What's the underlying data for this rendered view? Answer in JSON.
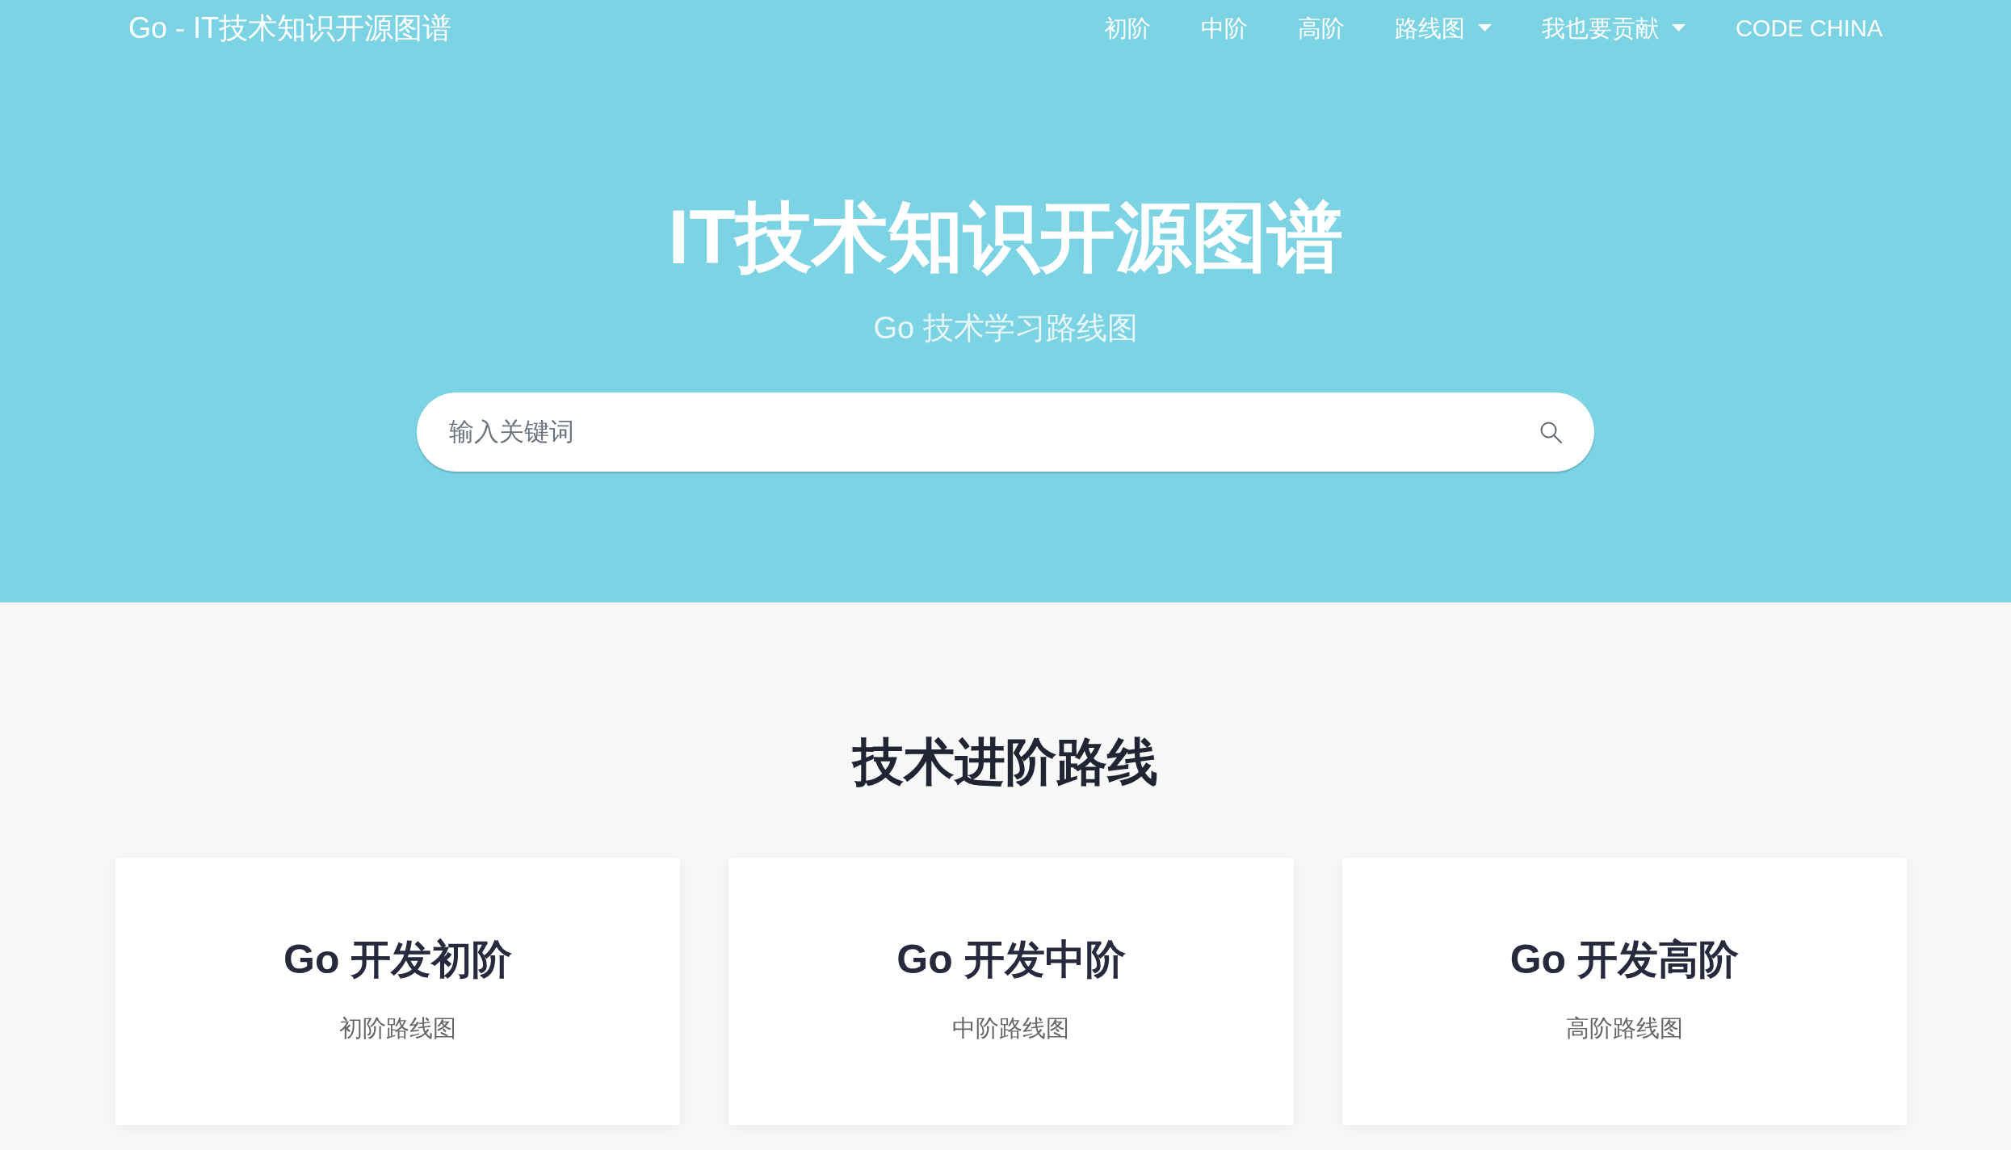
{
  "navbar": {
    "brand": "Go - IT技术知识开源图谱",
    "items": [
      {
        "label": "初阶",
        "kind": "link"
      },
      {
        "label": "中阶",
        "kind": "link"
      },
      {
        "label": "高阶",
        "kind": "link"
      },
      {
        "label": "路线图",
        "kind": "dropdown"
      },
      {
        "label": "我也要贡献",
        "kind": "dropdown"
      },
      {
        "label": "CODE CHINA",
        "kind": "link"
      }
    ]
  },
  "hero": {
    "title": "IT技术知识开源图谱",
    "subtitle": "Go 技术学习路线图",
    "search": {
      "placeholder": "输入关键词"
    }
  },
  "section": {
    "title": "技术进阶路线",
    "cards": [
      {
        "title": "Go 开发初阶",
        "subtitle": "初阶路线图"
      },
      {
        "title": "Go 开发中阶",
        "subtitle": "中阶路线图"
      },
      {
        "title": "Go 开发高阶",
        "subtitle": "高阶路线图"
      }
    ]
  }
}
